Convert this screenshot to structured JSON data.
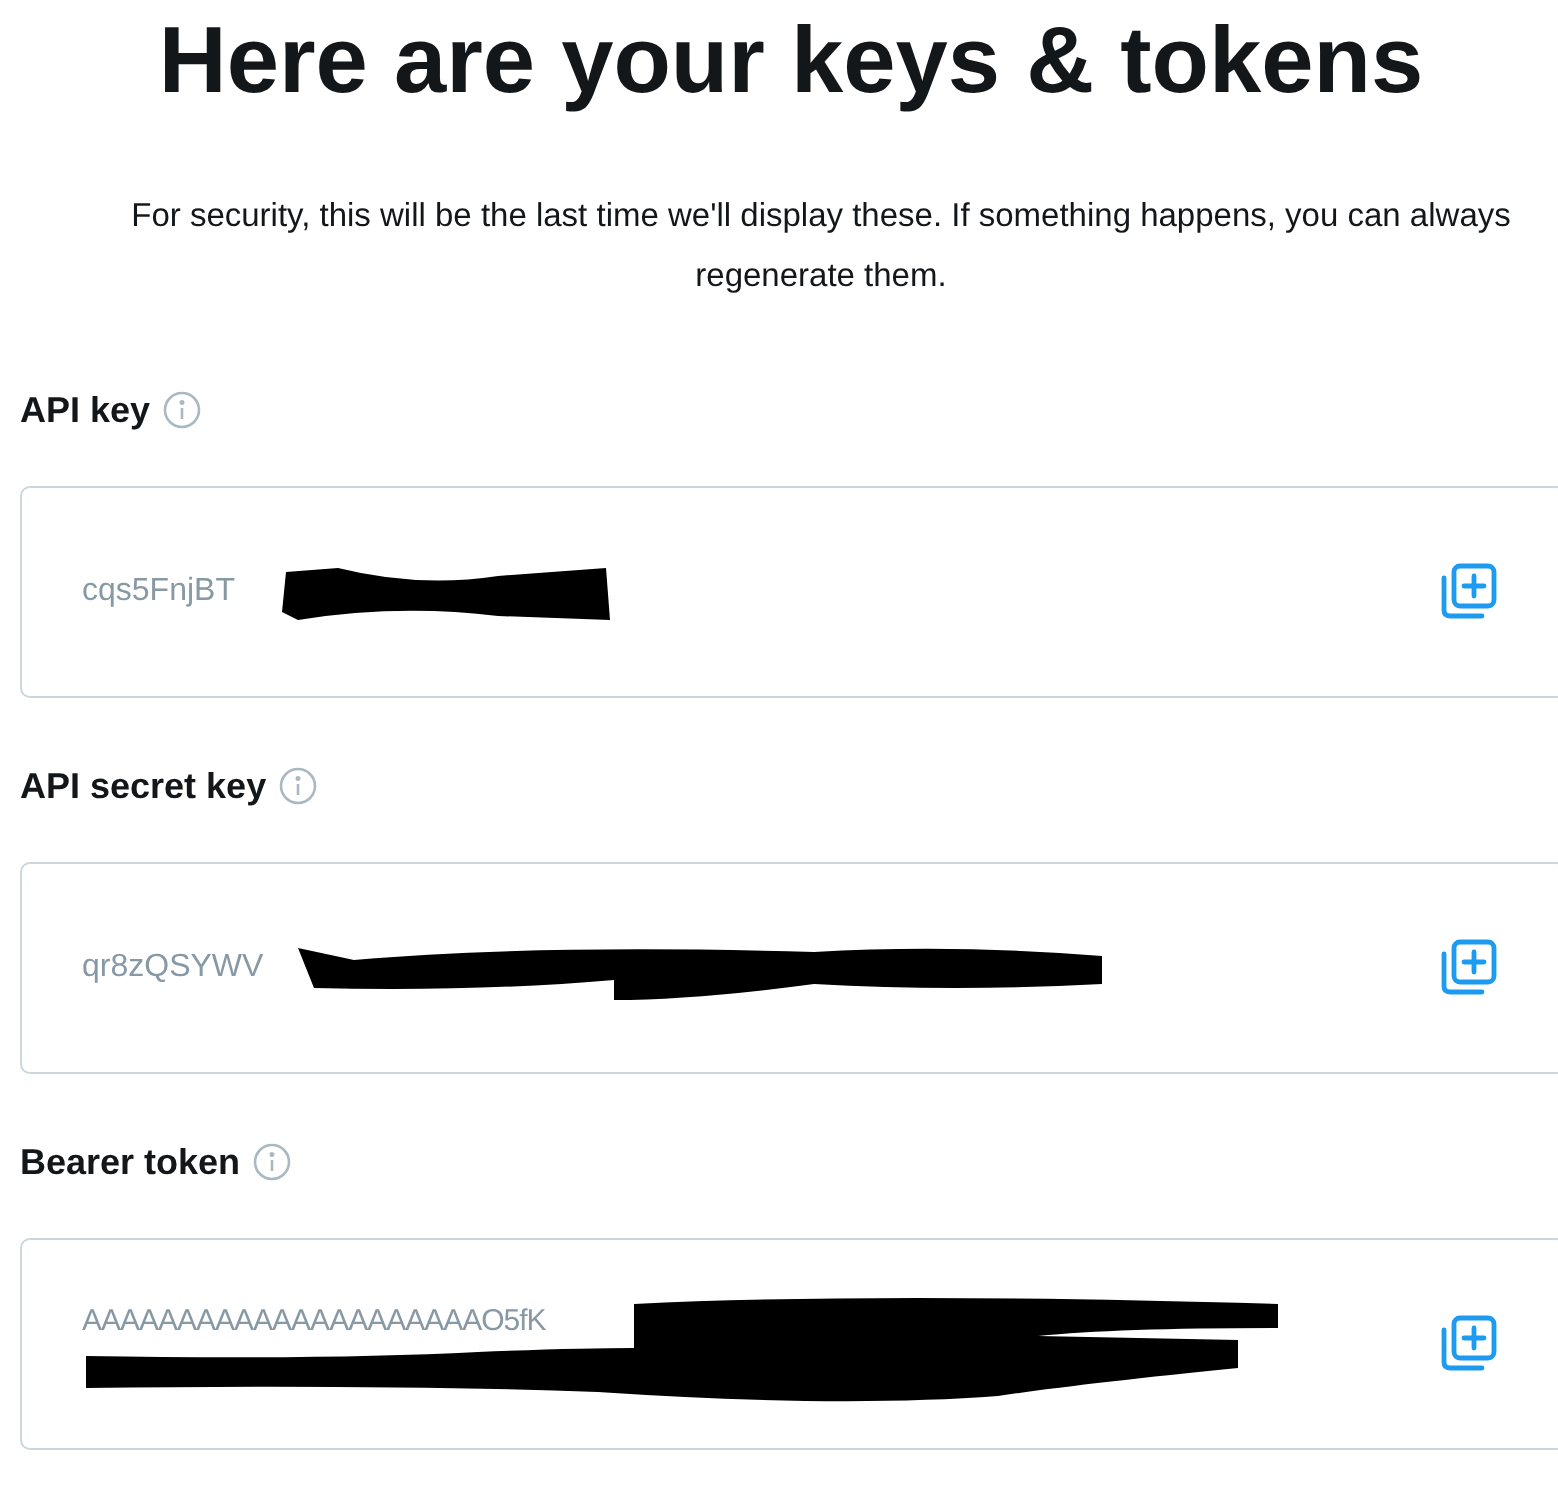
{
  "title": "Here are your keys & tokens",
  "intro": "For security, this will be the last time we'll display these. If something happens, you can always regenerate them.",
  "keys": [
    {
      "label": "API key",
      "value": "cqs5FnjBT",
      "kind": "short"
    },
    {
      "label": "API secret key",
      "value": "qr8zQSYWV",
      "kind": "long"
    },
    {
      "label": "Bearer token",
      "value": "AAAAAAAAAAAAAAAAAAAAAO5fK",
      "kind": "token"
    }
  ]
}
